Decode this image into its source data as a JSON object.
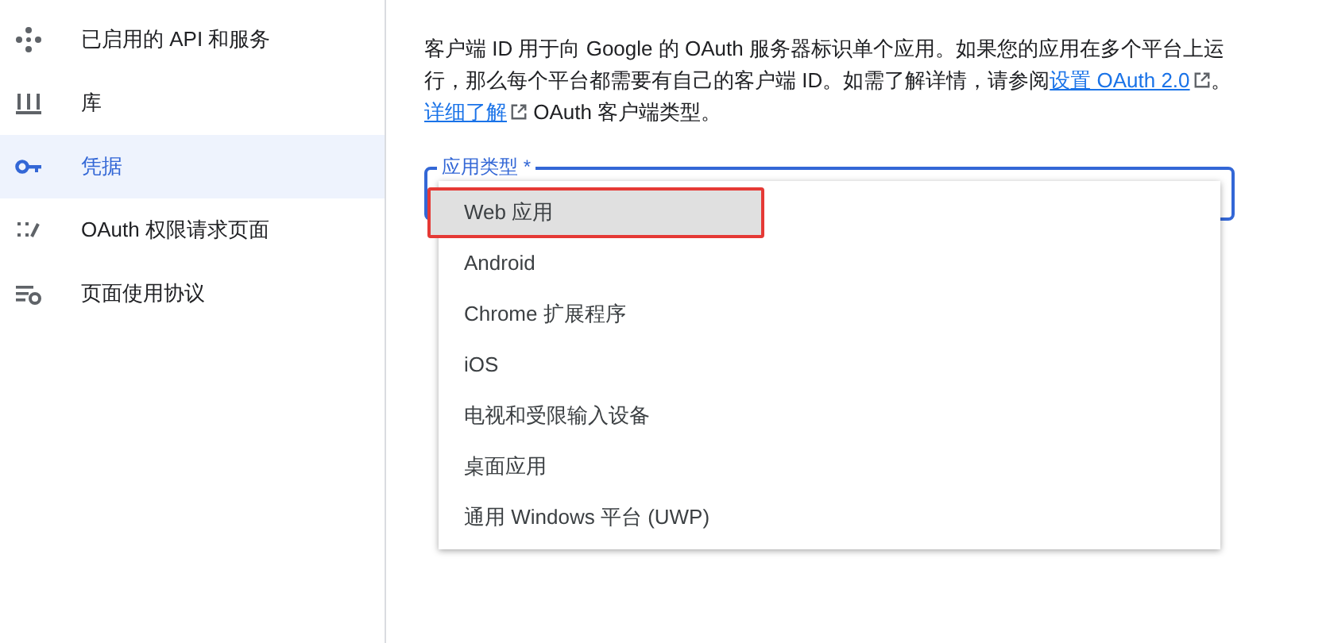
{
  "sidebar": {
    "items": [
      {
        "label": "已启用的 API 和服务",
        "kind": "apis",
        "selected": false
      },
      {
        "label": "库",
        "kind": "library",
        "selected": false
      },
      {
        "label": "凭据",
        "kind": "key",
        "selected": true
      },
      {
        "label": "OAuth 权限请求页面",
        "kind": "consent",
        "selected": false
      },
      {
        "label": "页面使用协议",
        "kind": "agreements",
        "selected": false
      }
    ]
  },
  "description": {
    "parts": [
      {
        "kind": "text",
        "text": "客户端 ID 用于向 Google 的 OAuth 服务器标识单个应用。如果您的应用在多个平台上运行，那么每个平台都需要有自己的客户端 ID。如需了解详情，请参阅"
      },
      {
        "kind": "link",
        "text": "设置 OAuth 2.0"
      },
      {
        "kind": "text",
        "text": "。"
      },
      {
        "kind": "link",
        "text": "详细了解"
      },
      {
        "kind": "text",
        "text": " OAuth 客户端类型。"
      }
    ]
  },
  "field": {
    "label": "应用类型 *",
    "focused": true
  },
  "dropdown": {
    "options": [
      {
        "label": "Web 应用",
        "selected": true,
        "outlined": true
      },
      {
        "label": "Android",
        "selected": false,
        "outlined": false
      },
      {
        "label": "Chrome 扩展程序",
        "selected": false,
        "outlined": false
      },
      {
        "label": "iOS",
        "selected": false,
        "outlined": false
      },
      {
        "label": "电视和受限输入设备",
        "selected": false,
        "outlined": false
      },
      {
        "label": "桌面应用",
        "selected": false,
        "outlined": false
      },
      {
        "label": "通用 Windows 平台 (UWP)",
        "selected": false,
        "outlined": false
      }
    ]
  }
}
